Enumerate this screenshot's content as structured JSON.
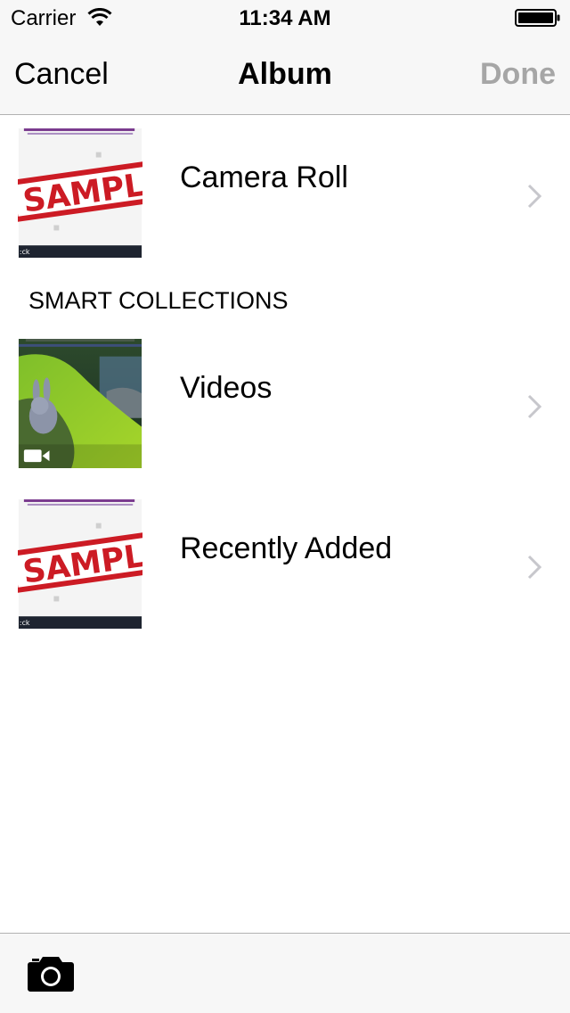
{
  "status_bar": {
    "carrier": "Carrier",
    "time": "11:34 AM",
    "icons": [
      "wifi-icon",
      "battery-icon"
    ]
  },
  "nav": {
    "cancel_label": "Cancel",
    "title": "Album",
    "done_label": "Done",
    "done_color": "#a6a6a6"
  },
  "albums": [
    {
      "label": "Camera Roll",
      "thumbnail": "sample-watermark"
    }
  ],
  "smart_collections": {
    "header": "SMART COLLECTIONS",
    "items": [
      {
        "label": "Videos",
        "thumbnail": "video-forest",
        "badge_icon": "video-camera-icon"
      },
      {
        "label": "Recently Added",
        "thumbnail": "sample-watermark"
      }
    ]
  },
  "toolbar": {
    "icons": [
      "camera-icon"
    ]
  },
  "colors": {
    "bar_background": "#f7f7f7",
    "separator": "#b2b2b2",
    "chevron": "#c7c7cc",
    "sample_red": "#cc1b24"
  }
}
